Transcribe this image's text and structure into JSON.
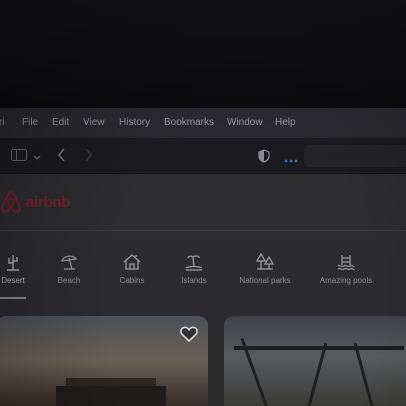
{
  "menubar": {
    "items": [
      "ri",
      "File",
      "Edit",
      "View",
      "History",
      "Bookmarks",
      "Window",
      "Help"
    ]
  },
  "toolbar": {
    "icons": [
      "sidebar-icon",
      "chevron-down-icon",
      "back-icon",
      "forward-icon",
      "privacy-shield-icon",
      "more-icon"
    ]
  },
  "site": {
    "logo_text": "airbnb",
    "brand_color": "#ff385c",
    "categories": [
      {
        "label": "Desert",
        "icon": "cactus-icon",
        "active": true
      },
      {
        "label": "Beach",
        "icon": "umbrella-icon",
        "active": false
      },
      {
        "label": "Cabins",
        "icon": "cabin-icon",
        "active": false
      },
      {
        "label": "Islands",
        "icon": "island-icon",
        "active": false
      },
      {
        "label": "National parks",
        "icon": "park-icon",
        "active": false
      },
      {
        "label": "Amazing pools",
        "icon": "pool-icon",
        "active": false
      }
    ],
    "listings": [
      {
        "favorite_icon": "heart-icon"
      },
      {}
    ]
  }
}
